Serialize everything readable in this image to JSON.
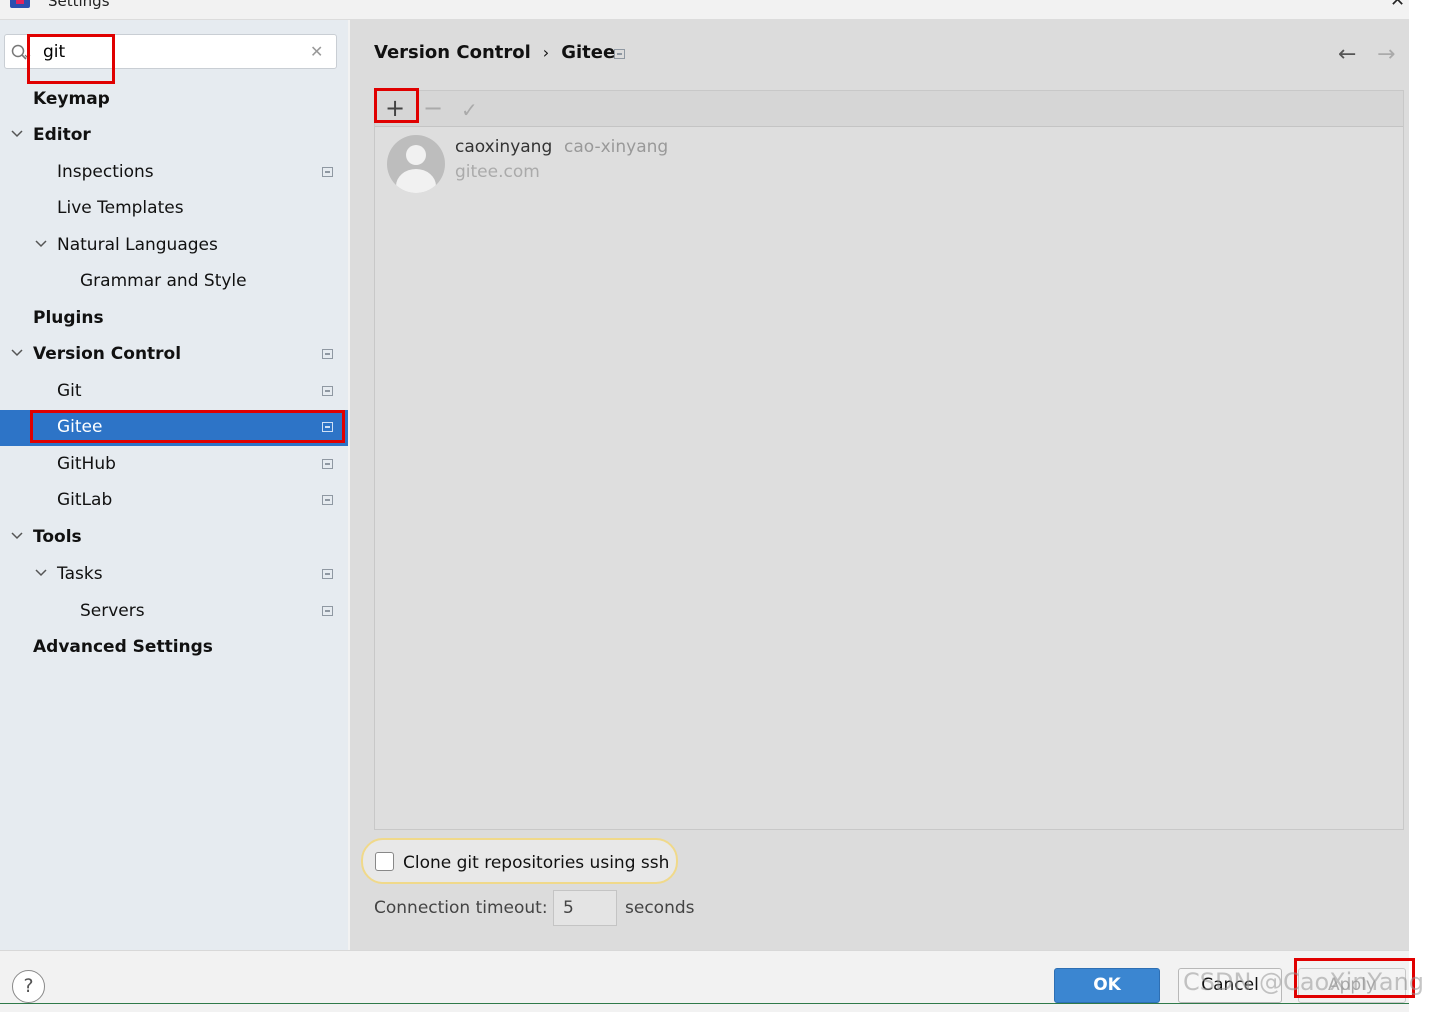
{
  "window": {
    "title": "Settings"
  },
  "search": {
    "value": "git"
  },
  "tree": [
    {
      "label": "Keymap"
    },
    {
      "label": "Editor"
    },
    {
      "label": "Inspections"
    },
    {
      "label": "Live Templates"
    },
    {
      "label": "Natural Languages"
    },
    {
      "label": "Grammar and Style"
    },
    {
      "label": "Plugins"
    },
    {
      "label": "Version Control"
    },
    {
      "label": "Git"
    },
    {
      "label": "Gitee"
    },
    {
      "label": "GitHub"
    },
    {
      "label": "GitLab"
    },
    {
      "label": "Tools"
    },
    {
      "label": "Tasks"
    },
    {
      "label": "Servers"
    },
    {
      "label": "Advanced Settings"
    }
  ],
  "breadcrumb": {
    "parent": "Version Control",
    "separator": "›",
    "current": "Gitee"
  },
  "toolbar": {
    "add": "+",
    "remove": "−",
    "apply_check": "✓"
  },
  "account": {
    "name": "caoxinyang",
    "login": "cao-xinyang",
    "server": "gitee.com"
  },
  "options": {
    "ssh_label": "Clone git repositories using ssh",
    "ssh_checked": false,
    "timeout_label": "Connection timeout:",
    "timeout_value": "5",
    "timeout_unit": "seconds"
  },
  "footer": {
    "help": "?",
    "ok": "OK",
    "cancel": "Cancel",
    "apply": "Apply"
  },
  "watermark": "CSDN @CaoXinYang",
  "colors": {
    "selection": "#2d74c7",
    "primary_button": "#3b86d1",
    "highlight_box": "#e00000"
  }
}
